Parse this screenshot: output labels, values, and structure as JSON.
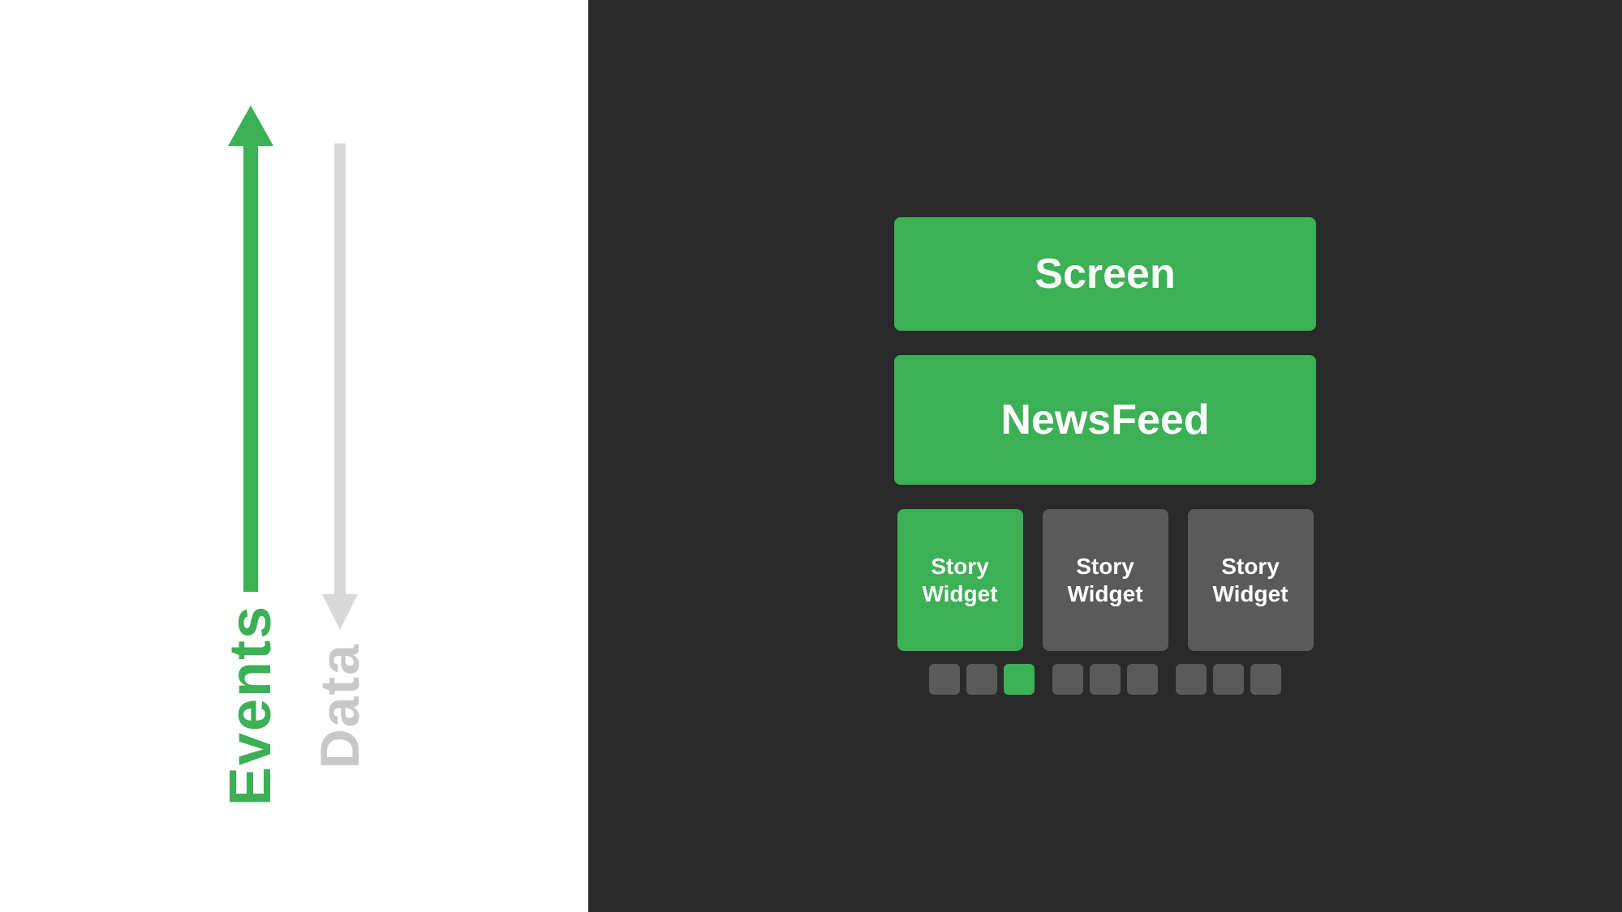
{
  "left": {
    "events_label": "Events",
    "data_label": "Data"
  },
  "right": {
    "screen_label": "Screen",
    "newsfeed_label": "NewsFeed",
    "story_widgets": [
      {
        "label": "Story\nWidget",
        "color": "green"
      },
      {
        "label": "Story\nWidget",
        "color": "gray"
      },
      {
        "label": "Story\nWidget",
        "color": "gray"
      }
    ],
    "dots_groups": [
      [
        "gray",
        "gray",
        "green"
      ],
      [
        "gray",
        "gray",
        "gray"
      ],
      [
        "gray",
        "gray",
        "gray"
      ]
    ]
  },
  "colors": {
    "green": "#3cb054",
    "gray": "#5a5a5a",
    "white": "#ffffff",
    "dark_bg": "#2a2a2a",
    "light_gray": "#d8d8d8"
  }
}
